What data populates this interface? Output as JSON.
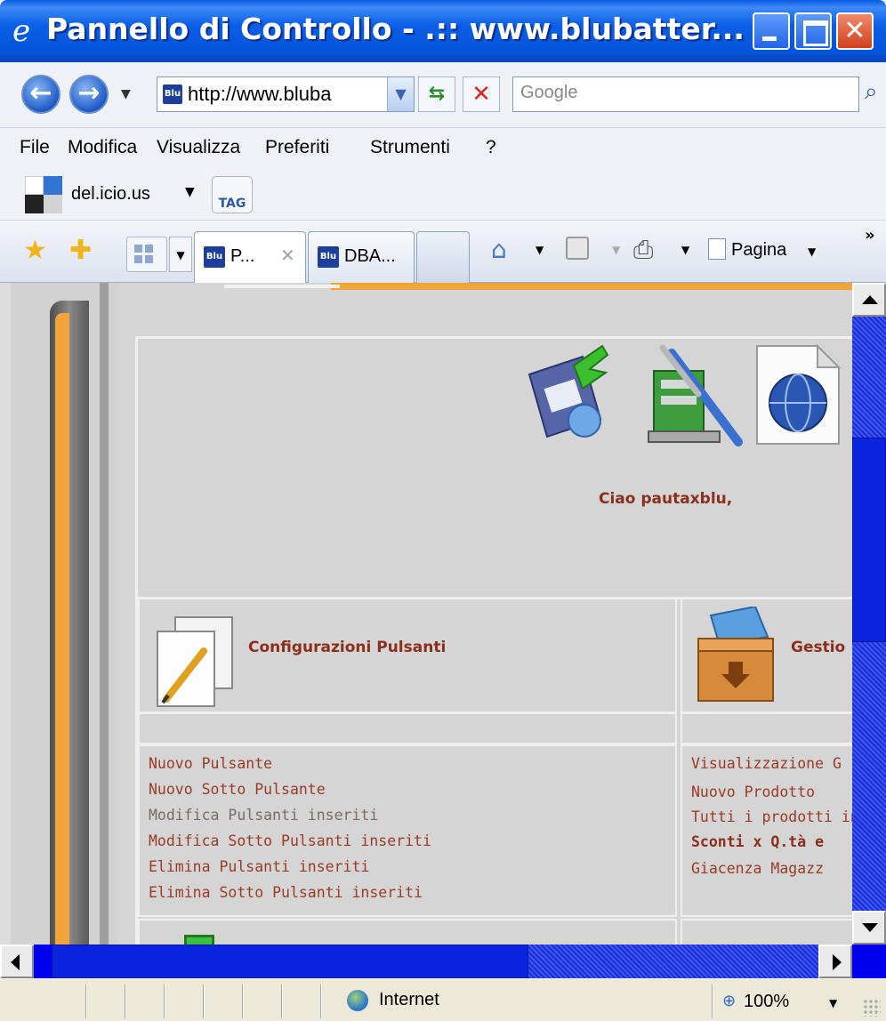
{
  "window": {
    "title": "Pannello di Controllo - .:: www.blubatter...",
    "close_glyph": "✕"
  },
  "navigation": {
    "address": "http://www.bluba",
    "favicon_text": "Blu",
    "search_placeholder": "Google"
  },
  "menu": {
    "items": [
      "File",
      "Modifica",
      "Visualizza",
      "Preferiti",
      "Strumenti",
      "?"
    ]
  },
  "links_bar": {
    "delicious_label": "del.icio.us",
    "tag_label": "TAG"
  },
  "tabs": {
    "items": [
      {
        "label": "P...",
        "favicon_text": "Blu",
        "active": true
      },
      {
        "label": "DBA...",
        "favicon_text": "Blu",
        "active": false
      }
    ],
    "page_menu_label": "Pagina",
    "overflow_glyph": "»"
  },
  "content": {
    "greeting": "Ciao pautaxblu,",
    "sections": [
      {
        "title": "Configurazioni Pulsanti",
        "icon": "document-edit-icon",
        "links": [
          {
            "label": "Nuovo Pulsante",
            "style": "normal"
          },
          {
            "label": "Nuovo Sotto Pulsante",
            "style": "normal"
          },
          {
            "label": "Modifica Pulsanti inseriti",
            "style": "gray"
          },
          {
            "label": "Modifica Sotto Pulsanti inseriti",
            "style": "normal"
          },
          {
            "label": "Elimina Pulsanti inseriti",
            "style": "normal"
          },
          {
            "label": "Elimina Sotto Pulsanti inseriti",
            "style": "normal"
          }
        ]
      },
      {
        "title": "Gestio",
        "icon": "product-box-icon",
        "links": [
          {
            "label": "Visualizzazione G",
            "style": "normal"
          },
          {
            "label": "Nuovo Prodotto",
            "style": "normal"
          },
          {
            "label": "Tutti i prodotti ins",
            "style": "normal"
          },
          {
            "label": "Sconti x Q.tà e",
            "style": "bold"
          },
          {
            "label": "Giacenza Magazz",
            "style": "normal"
          }
        ]
      }
    ]
  },
  "status_bar": {
    "zone": "Internet",
    "zoom": "100%"
  },
  "colors": {
    "link": "#9a3b26",
    "heading": "#8b2f1d",
    "titlebar": "#0553d8",
    "scrollbar": "#0000ee",
    "accent_orange": "#f3a43d"
  }
}
